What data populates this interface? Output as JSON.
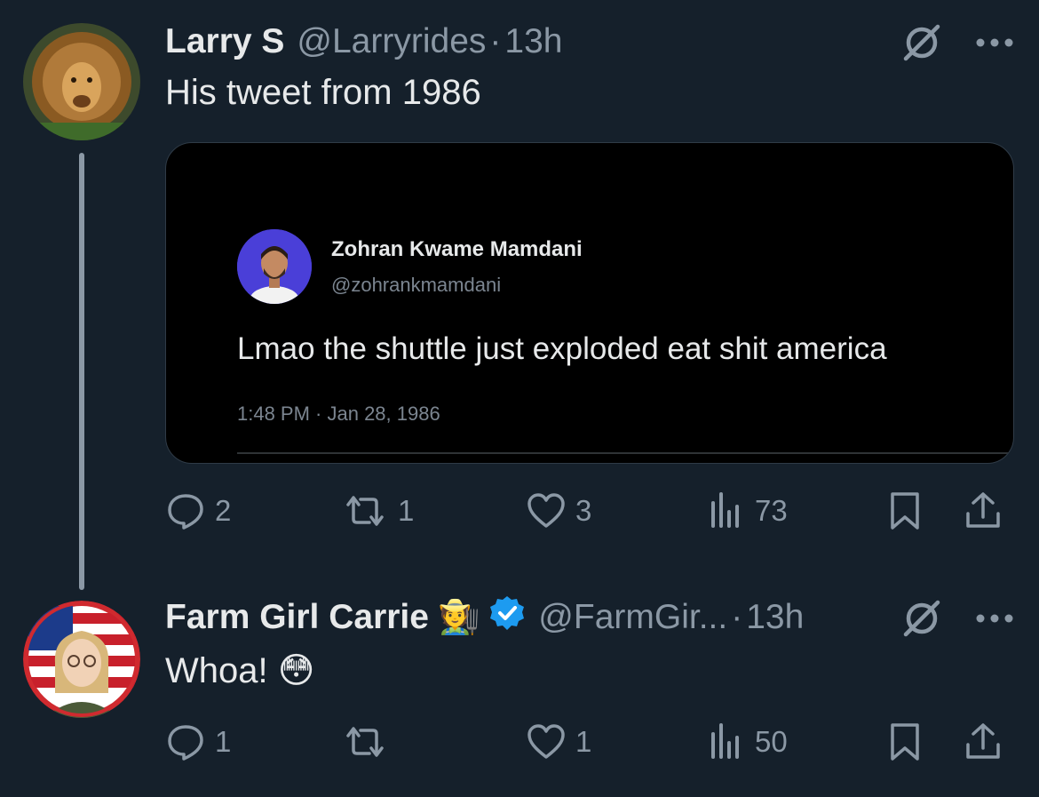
{
  "posts": [
    {
      "display_name": "Larry S",
      "handle": "@Larryrides",
      "separator": "·",
      "time": "13h",
      "text": "His tweet from 1986",
      "embed": {
        "name": "Zohran Kwame Mamdani",
        "handle": "@zohrankmamdani",
        "text": "Lmao the shuttle just exploded eat shit america",
        "datetime": "1:48 PM · Jan 28, 1986"
      },
      "actions": {
        "replies": "2",
        "reposts": "1",
        "likes": "3",
        "views": "73"
      }
    },
    {
      "display_name": "Farm Girl Carrie",
      "name_emoji": "🧑‍🌾",
      "handle": "@FarmGir...",
      "separator": "·",
      "time": "13h",
      "text": "Whoa! 😳",
      "actions": {
        "replies": "1",
        "reposts": "",
        "likes": "1",
        "views": "50"
      }
    }
  ],
  "icons": {
    "reply": "speech-bubble",
    "repost": "arrows-loop",
    "like": "heart",
    "views": "bar-chart",
    "bookmark": "bookmark",
    "share": "share-up-arrow",
    "blocked": "no-sign",
    "more": "ellipsis",
    "verified": "blue-check-badge"
  },
  "colors": {
    "background": "#15202b",
    "text": "#e7e9ea",
    "muted": "#8b98a5",
    "verified": "#1d9bf0"
  }
}
